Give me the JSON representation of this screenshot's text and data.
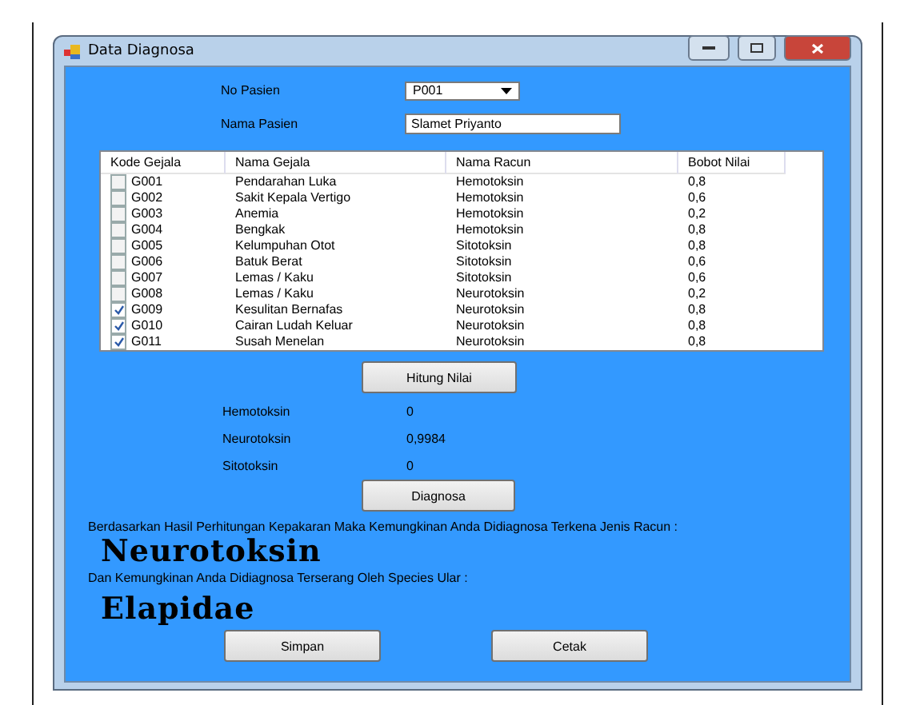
{
  "window": {
    "title": "Data Diagnosa"
  },
  "patient": {
    "no_label": "No Pasien",
    "no_value": "P001",
    "name_label": "Nama Pasien",
    "name_value": "Slamet Priyanto"
  },
  "table": {
    "columns": [
      "Kode Gejala",
      "Nama Gejala",
      "Nama Racun",
      "Bobot Nilai"
    ],
    "rows": [
      {
        "code": "G001",
        "name": "Pendarahan Luka",
        "poison": "Hemotoksin",
        "weight": "0,8",
        "checked": false
      },
      {
        "code": "G002",
        "name": "Sakit Kepala Vertigo",
        "poison": "Hemotoksin",
        "weight": "0,6",
        "checked": false
      },
      {
        "code": "G003",
        "name": "Anemia",
        "poison": "Hemotoksin",
        "weight": "0,2",
        "checked": false
      },
      {
        "code": "G004",
        "name": "Bengkak",
        "poison": "Hemotoksin",
        "weight": "0,8",
        "checked": false
      },
      {
        "code": "G005",
        "name": "Kelumpuhan Otot",
        "poison": "Sitotoksin",
        "weight": "0,8",
        "checked": false
      },
      {
        "code": "G006",
        "name": "Batuk Berat",
        "poison": "Sitotoksin",
        "weight": "0,6",
        "checked": false
      },
      {
        "code": "G007",
        "name": "Lemas / Kaku",
        "poison": "Sitotoksin",
        "weight": "0,6",
        "checked": false
      },
      {
        "code": "G008",
        "name": "Lemas / Kaku",
        "poison": "Neurotoksin",
        "weight": "0,2",
        "checked": false
      },
      {
        "code": "G009",
        "name": "Kesulitan Bernafas",
        "poison": "Neurotoksin",
        "weight": "0,8",
        "checked": true
      },
      {
        "code": "G010",
        "name": "Cairan Ludah Keluar",
        "poison": "Neurotoksin",
        "weight": "0,8",
        "checked": true
      },
      {
        "code": "G011",
        "name": "Susah Menelan",
        "poison": "Neurotoksin",
        "weight": "0,8",
        "checked": true
      }
    ]
  },
  "compute_button": "Hitung Nilai",
  "results": [
    {
      "label": "Hemotoksin",
      "value": "0"
    },
    {
      "label": "Neurotoksin",
      "value": "0,9984"
    },
    {
      "label": "Sitotoksin",
      "value": "0"
    }
  ],
  "diagnose_button": "Diagnosa",
  "poison_sentence": "Berdasarkan Hasil Perhitungan Kepakaran Maka Kemungkinan Anda Didiagnosa Terkena Jenis Racun :",
  "poison_result": "Neurotoksin",
  "species_sentence": "Dan Kemungkinan Anda Didiagnosa Terserang Oleh Species Ular :",
  "species_result": "Elapidae",
  "buttons": [
    "Simpan",
    "Cetak"
  ]
}
